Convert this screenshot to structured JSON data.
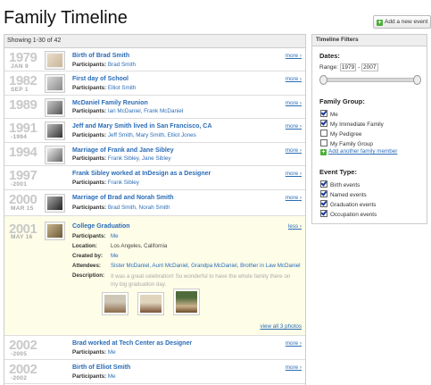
{
  "title": "Family Timeline",
  "add_button": "Add a new event",
  "list_header": {
    "showing": "Showing 1-30 of",
    "total": "42"
  },
  "events": [
    {
      "year": "1979",
      "date": "JAN 9",
      "title": "Birth of Brad Smith",
      "participants_label": "Participants:",
      "participants": "Brad Smith",
      "more": "more"
    },
    {
      "year": "1982",
      "date": "SEP 1",
      "title": "First day of School",
      "participants_label": "Participants:",
      "participants": "Elliot Smith",
      "more": "more"
    },
    {
      "year": "1989",
      "date": "",
      "title": "McDaniel Family Reunion",
      "participants_label": "Participants:",
      "participants": "Ian McDaniel, Frank McDaniel",
      "more": "more"
    },
    {
      "year": "1991",
      "date": "-1994",
      "title": "Jeff and Mary Smith lived in San Francisco, CA",
      "participants_label": "Participants:",
      "participants": "Jeff Smith, Mary Smith, Elliot Jones",
      "more": "more"
    },
    {
      "year": "1994",
      "date": "",
      "title": "Marriage of Frank and Jane Sibley",
      "participants_label": "Participants:",
      "participants": "Frank Sibley, Jane Sibley",
      "more": "more"
    },
    {
      "year": "1997",
      "date": "-2001",
      "title": "Frank Sibley worked at InDesign as a Designer",
      "participants_label": "Participants:",
      "participants": "Frank Sibley",
      "more": "more"
    },
    {
      "year": "2000",
      "date": "MAR 15",
      "title": "Marriage of Brad and Norah Smith",
      "participants_label": "Participants:",
      "participants": "Brad Smith, Norah Smith",
      "more": "more"
    }
  ],
  "expanded": {
    "year": "2001",
    "date": "MAY 16",
    "title": "College Graduation",
    "less": "less",
    "participants_label": "Participants:",
    "participants": "Me",
    "location_label": "Location:",
    "location": "Los Angeles, California",
    "created_label": "Created by:",
    "created": "Me",
    "attendees_label": "Attendees:",
    "attendees": "Sister McDaniel, Aunt McDaniel, Grandpa McDaniel, Brother in Law McDaniel",
    "description_label": "Description:",
    "description": "It was a great celebration! So wonderful to have the whole family there on my big graduation day.",
    "view_all": "view all 3 photos"
  },
  "events_after": [
    {
      "year": "2002",
      "date": "-2005",
      "title": "Brad worked at Tech Center as Designer",
      "participants_label": "Participants:",
      "participants": "Me",
      "more": "more"
    },
    {
      "year": "2002",
      "date": "-2002",
      "title": "Birth of Elliot Smith",
      "participants_label": "Participants:",
      "participants": "Me",
      "more": "more"
    }
  ],
  "filters": {
    "header": "Timeline Filters",
    "dates_label": "Dates:",
    "range_label": "Range:",
    "range_from": "1979",
    "range_sep": "-",
    "range_to": "2007",
    "family_label": "Family Group:",
    "family": [
      {
        "label": "Me",
        "checked": true
      },
      {
        "label": "My Immediate Family",
        "checked": true
      },
      {
        "label": "My Pedigree",
        "checked": false
      },
      {
        "label": "My Family Group",
        "checked": false
      }
    ],
    "add_family": "Add another family member",
    "event_label": "Event Type:",
    "event_types": [
      {
        "label": "Birth events",
        "checked": true
      },
      {
        "label": "Named events",
        "checked": true
      },
      {
        "label": "Graduation events",
        "checked": true
      },
      {
        "label": "Occupation events",
        "checked": true
      }
    ]
  },
  "colors": {
    "link": "#2a6cb6",
    "year": "#c9c9c9",
    "expanded_bg": "#fdfde8"
  }
}
